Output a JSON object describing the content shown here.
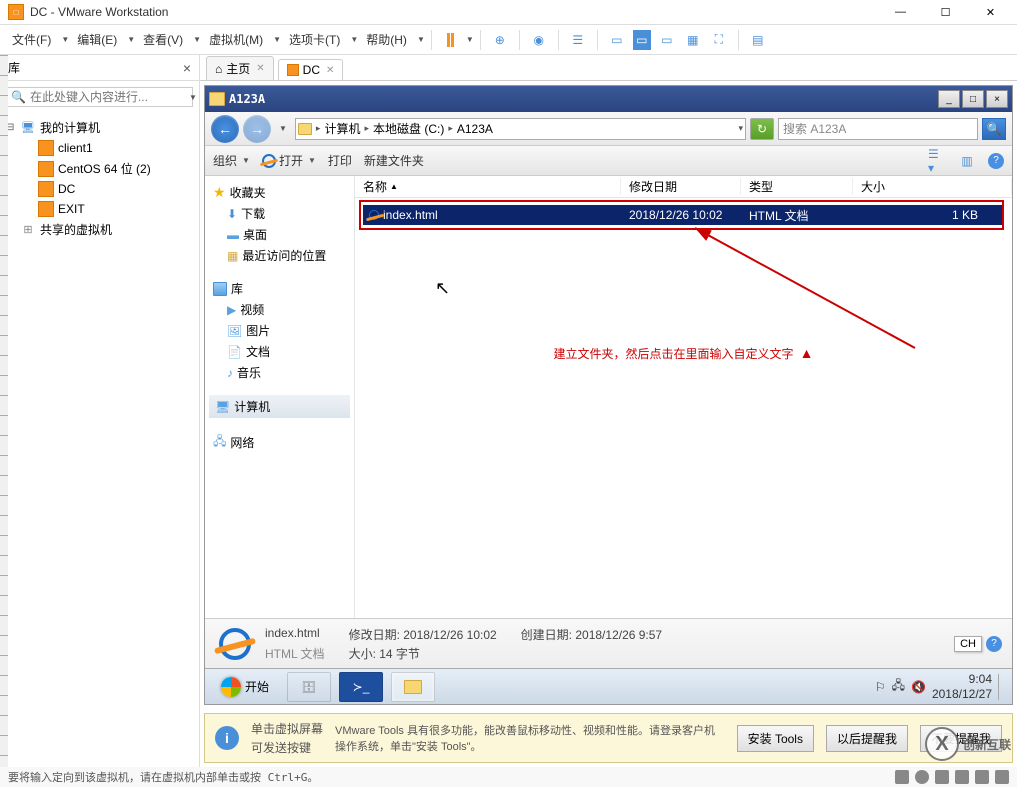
{
  "app": {
    "title": "DC - VMware Workstation"
  },
  "menu": {
    "items": [
      "文件(F)",
      "编辑(E)",
      "查看(V)",
      "虚拟机(M)",
      "选项卡(T)",
      "帮助(H)"
    ]
  },
  "sidebar": {
    "title": "库",
    "search_placeholder": "在此处键入内容进行...",
    "tree": {
      "root": "我的计算机",
      "items": [
        "client1",
        "CentOS 64 位 (2)",
        "DC",
        "EXIT"
      ],
      "shared": "共享的虚拟机"
    }
  },
  "tabs": {
    "home": "主页",
    "vm": "DC"
  },
  "explorer": {
    "title": "A123A",
    "address": {
      "computer": "计算机",
      "disk": "本地磁盘 (C:)",
      "folder": "A123A"
    },
    "search_placeholder": "搜索 A123A",
    "toolbar": {
      "organize": "组织",
      "open": "打开",
      "print": "打印",
      "newfolder": "新建文件夹"
    },
    "tree": {
      "favorites": "收藏夹",
      "fav_items": [
        "下载",
        "桌面",
        "最近访问的位置"
      ],
      "library": "库",
      "lib_items": [
        "视频",
        "图片",
        "文档",
        "音乐"
      ],
      "computer": "计算机",
      "network": "网络"
    },
    "columns": {
      "name": "名称",
      "date": "修改日期",
      "type": "类型",
      "size": "大小"
    },
    "file": {
      "name": "index.html",
      "date": "2018/12/26 10:02",
      "type": "HTML 文档",
      "size": "1 KB"
    },
    "details": {
      "filename": "index.html",
      "filetype": "HTML 文档",
      "mod_label": "修改日期:",
      "mod_value": "2018/12/26 10:02",
      "size_label": "大小:",
      "size_value": "14 字节",
      "created_label": "创建日期:",
      "created_value": "2018/12/26 9:57"
    }
  },
  "annotation": "建立文件夹，然后点击在里面输入自定义文字",
  "lang_indicator": "CH",
  "taskbar": {
    "start": "开始",
    "time": "9:04",
    "date": "2018/12/27"
  },
  "infobar": {
    "left1": "单击虚拟屏幕",
    "left2": "可发送按键",
    "text": "VMware Tools 具有很多功能，能改善鼠标移动性、视频和性能。请登录客户机操作系统，单击\"安装 Tools\"。",
    "btn1": "安装 Tools",
    "btn2": "以后提醒我",
    "btn3": "不要提醒我"
  },
  "status": "要将输入定向到该虚拟机，请在虚拟机内部单击或按 Ctrl+G。",
  "watermark": "创新互联"
}
